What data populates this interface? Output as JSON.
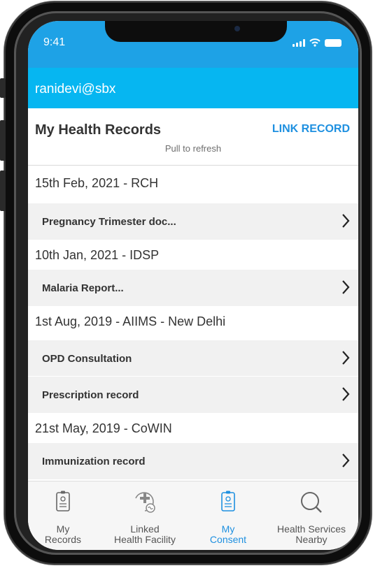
{
  "status_bar": {
    "time": "9:41"
  },
  "user_bar": {
    "username": "ranidevi@sbx"
  },
  "header": {
    "title": "My Health Records",
    "link_label": "LINK RECORD",
    "subtitle": "Pull to refresh"
  },
  "groups": [
    {
      "heading": "15th Feb, 2021 - RCH",
      "records": [
        {
          "label": "Pregnancy Trimester doc..."
        }
      ]
    },
    {
      "heading": "10th Jan, 2021 - IDSP",
      "records": [
        {
          "label": "Malaria Report..."
        }
      ]
    },
    {
      "heading": "1st Aug, 2019 - AIIMS - New Delhi",
      "records": [
        {
          "label": "OPD Consultation"
        },
        {
          "label": "Prescription record"
        }
      ]
    },
    {
      "heading": "21st May, 2019 - CoWIN",
      "records": [
        {
          "label": "Immunization record"
        }
      ]
    }
  ],
  "tabs": [
    {
      "label": "My\nRecords",
      "icon": "records-icon",
      "active": false
    },
    {
      "label": "Linked\nHealth Facility",
      "icon": "health-facility-icon",
      "active": false
    },
    {
      "label": "My\nConsent",
      "icon": "consent-icon",
      "active": true
    },
    {
      "label": "Health Services\nNearby",
      "icon": "search-icon",
      "active": false
    }
  ],
  "colors": {
    "status_bar": "#1ea2e6",
    "user_bar": "#06b6f1",
    "accent": "#1e90e0",
    "record_bg": "#f1f1f1"
  }
}
